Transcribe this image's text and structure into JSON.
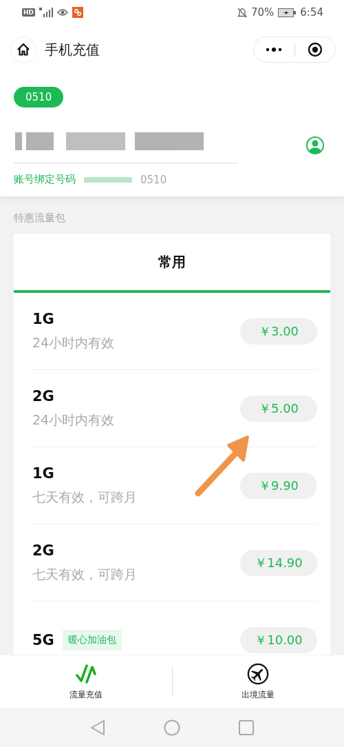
{
  "status_bar": {
    "hd": "HD",
    "battery_percent": "70%",
    "time": "6:54"
  },
  "header": {
    "title": "手机充值"
  },
  "account": {
    "area_code": "0510",
    "bound_label": "账号绑定号码",
    "bound_code": "0510"
  },
  "section_title": "特惠流量包",
  "tabs": [
    {
      "label": "常用",
      "selected": true
    }
  ],
  "packages": [
    {
      "size": "1G",
      "validity": "24小时内有效",
      "price": "￥3.00"
    },
    {
      "size": "2G",
      "validity": "24小时内有效",
      "price": "￥5.00"
    },
    {
      "size": "1G",
      "validity": "七天有效，可跨月",
      "price": "￥9.90"
    },
    {
      "size": "2G",
      "validity": "七天有效，可跨月",
      "price": "￥14.90"
    },
    {
      "size": "5G",
      "tag": "暖心加油包",
      "price": "￥10.00"
    }
  ],
  "bottom_tabs": [
    {
      "label": "流量充值",
      "selected": true,
      "kind": "recharge"
    },
    {
      "label": "出境流量",
      "selected": false,
      "kind": "roaming"
    }
  ]
}
